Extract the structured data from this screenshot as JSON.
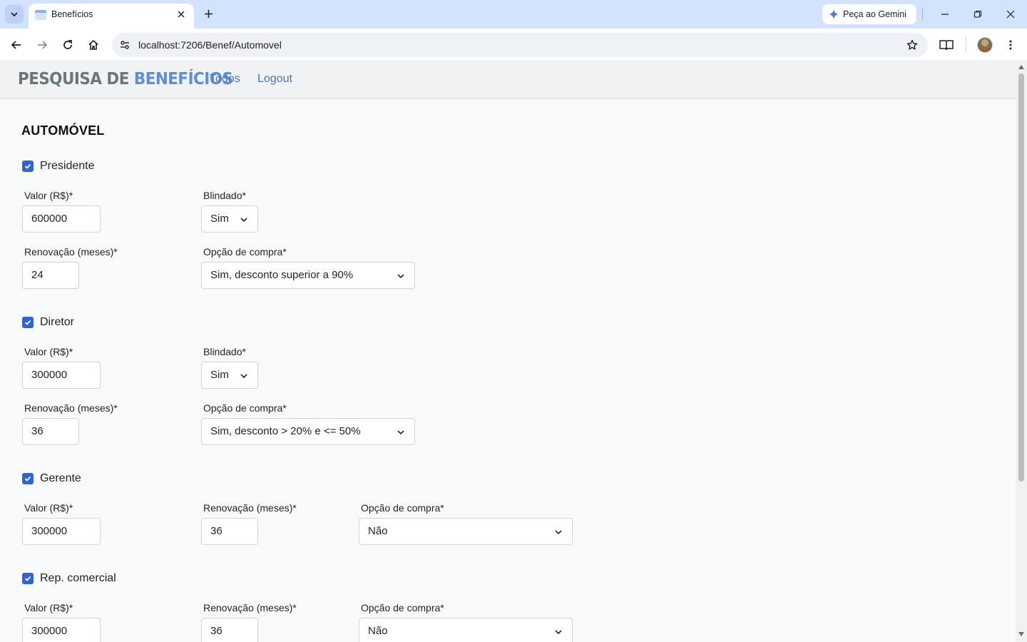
{
  "browser": {
    "tab_title": "Benefícios",
    "gemini_label": "Peça ao Gemini",
    "url": "localhost:7206/Benef/Automovel"
  },
  "navbar": {
    "brand_part1": "PESQUISA DE ",
    "brand_part2": "BENEFÍCIOS",
    "links": [
      "Todos",
      "Logout"
    ]
  },
  "page": {
    "title": "AUTOMÓVEL",
    "sections": [
      {
        "name": "Presidente",
        "checked": true,
        "valor_label": "Valor (R$)*",
        "valor": "600000",
        "blindado_label": "Blindado*",
        "blindado": "Sim",
        "renovacao_label": "Renovação (meses)*",
        "renovacao": "24",
        "compra_label": "Opção de compra*",
        "compra": "Sim, desconto superior a 90%"
      },
      {
        "name": "Diretor",
        "checked": true,
        "valor_label": "Valor (R$)*",
        "valor": "300000",
        "blindado_label": "Blindado*",
        "blindado": "Sim",
        "renovacao_label": "Renovação (meses)*",
        "renovacao": "36",
        "compra_label": "Opção de compra*",
        "compra": "Sim, desconto > 20% e <= 50%"
      },
      {
        "name": "Gerente",
        "checked": true,
        "valor_label": "Valor (R$)*",
        "valor": "300000",
        "renovacao_label": "Renovação (meses)*",
        "renovacao": "36",
        "compra_label": "Opção de compra*",
        "compra": "Não"
      },
      {
        "name": "Rep. comercial",
        "checked": true,
        "valor_label": "Valor (R$)*",
        "valor": "300000",
        "renovacao_label": "Renovação (meses)*",
        "renovacao": "36",
        "compra_label": "Opção de compra*",
        "compra": "Não"
      }
    ]
  },
  "colors": {
    "accent": "#2f63d6",
    "brand_gray": "#6c757d",
    "brand_blue": "#5b8fd6",
    "link": "#4a74b8"
  }
}
